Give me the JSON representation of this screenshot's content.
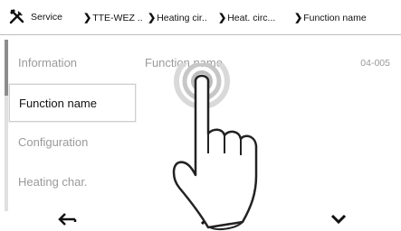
{
  "breadcrumb": [
    {
      "label": "Service"
    },
    {
      "label": "TTE-WEZ .."
    },
    {
      "label": "Heating cir.."
    },
    {
      "label": "Heat. circ..."
    },
    {
      "label": "Function name"
    }
  ],
  "menu": [
    {
      "label": "Information",
      "selected": false
    },
    {
      "label": "Function name",
      "selected": true
    },
    {
      "label": "Configuration",
      "selected": false
    },
    {
      "label": "Heating char.",
      "selected": false
    }
  ],
  "detail": {
    "label": "Function name",
    "code": "04-005"
  },
  "icons": {
    "tool": "tools-icon",
    "back": "back-arrow-icon",
    "up": "chevron-up-icon",
    "down": "chevron-down-icon",
    "gesture": "tap-gesture-icon"
  },
  "scroll": {
    "position_fraction": 0.0,
    "visible_fraction": 0.33
  }
}
